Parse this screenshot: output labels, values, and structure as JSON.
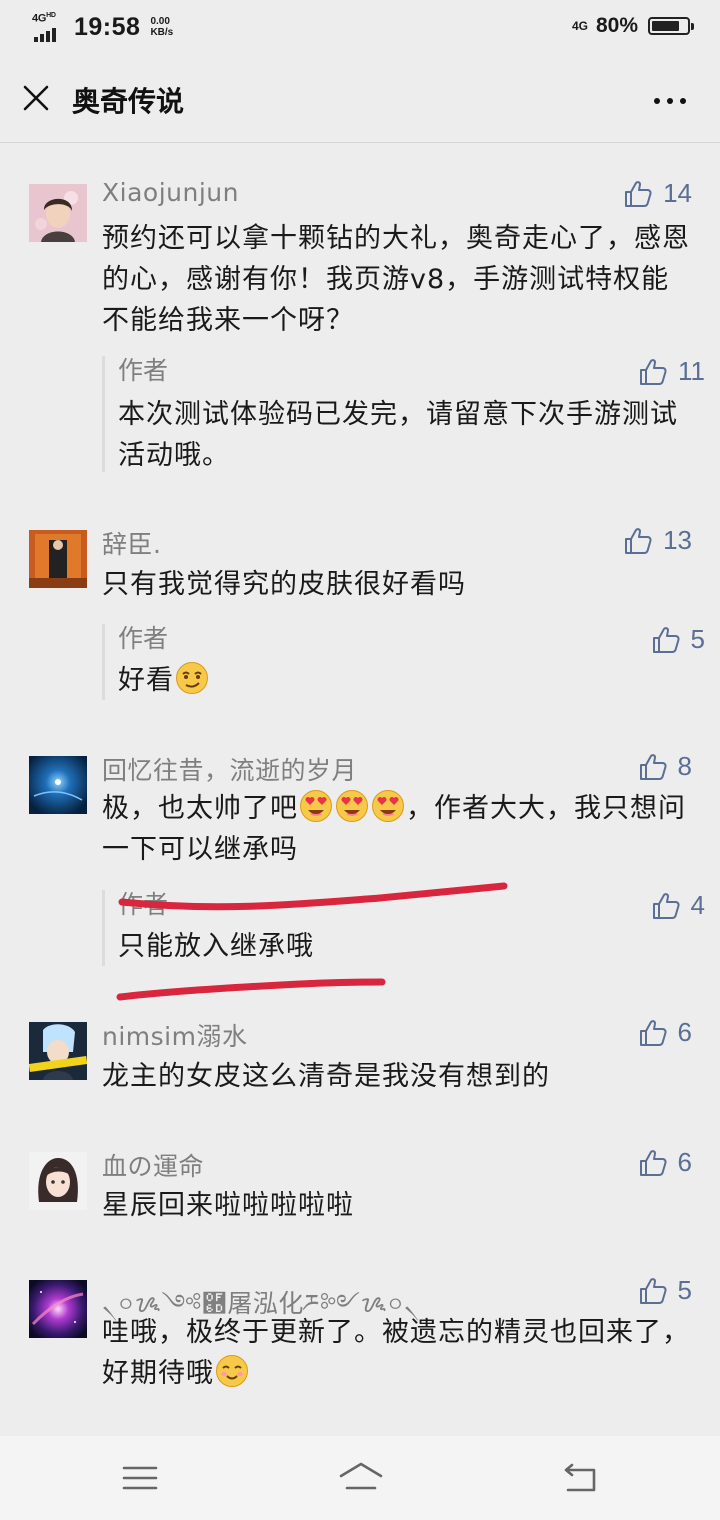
{
  "status_bar": {
    "network": "4G",
    "network_sup": "HD",
    "time": "19:58",
    "speed_value": "0.00",
    "speed_unit": "KB/s",
    "network_right": "4G",
    "battery": "80%",
    "battery_level": 0.8
  },
  "header": {
    "title": "奥奇传说"
  },
  "comments": [
    {
      "name": "Xiaojunjun",
      "text": "预约还可以拿十颗钻的大礼，奥奇走心了，感恩的心，感谢有你！我页游v8，手游测试特权能不能给我来一个呀？",
      "likes": "14",
      "reply": {
        "name": "作者",
        "text": "本次测试体验码已发完，请留意下次手游测试活动哦。",
        "likes": "11"
      }
    },
    {
      "name": "辞臣.",
      "text": "只有我觉得究的皮肤很好看吗",
      "likes": "13",
      "reply": {
        "name": "作者",
        "text": "好看",
        "likes": "5",
        "emoji": "smirk-emoji"
      }
    },
    {
      "name": "回忆往昔，流逝的岁月",
      "text_a": "极，也太帅了吧",
      "text_b": "，作者大大，我只想问一下可以继承吗",
      "likes": "8",
      "reply": {
        "name": "作者",
        "text": "只能放入继承哦",
        "likes": "4"
      }
    },
    {
      "name": "nimsim溺水",
      "text": "龙主的女皮这么清奇是我没有想到的",
      "likes": "6"
    },
    {
      "name": "血の運命",
      "text": "星辰回来啦啦啦啦啦",
      "likes": "6"
    },
    {
      "name": "৲০ᝰ༺཭屠泓化ཬ༻ᝰ০৲",
      "text": "哇哦，极终于更新了。被遗忘的精灵也回来了，好期待哦",
      "likes": "5"
    }
  ],
  "colors": {
    "background": "#ededed",
    "like_icon": "#5a6f93",
    "name_gray": "#7f7f7f",
    "annotation_red": "#d7263d"
  },
  "nav": {
    "icons": [
      "menu-icon",
      "home-icon",
      "back-icon"
    ]
  }
}
